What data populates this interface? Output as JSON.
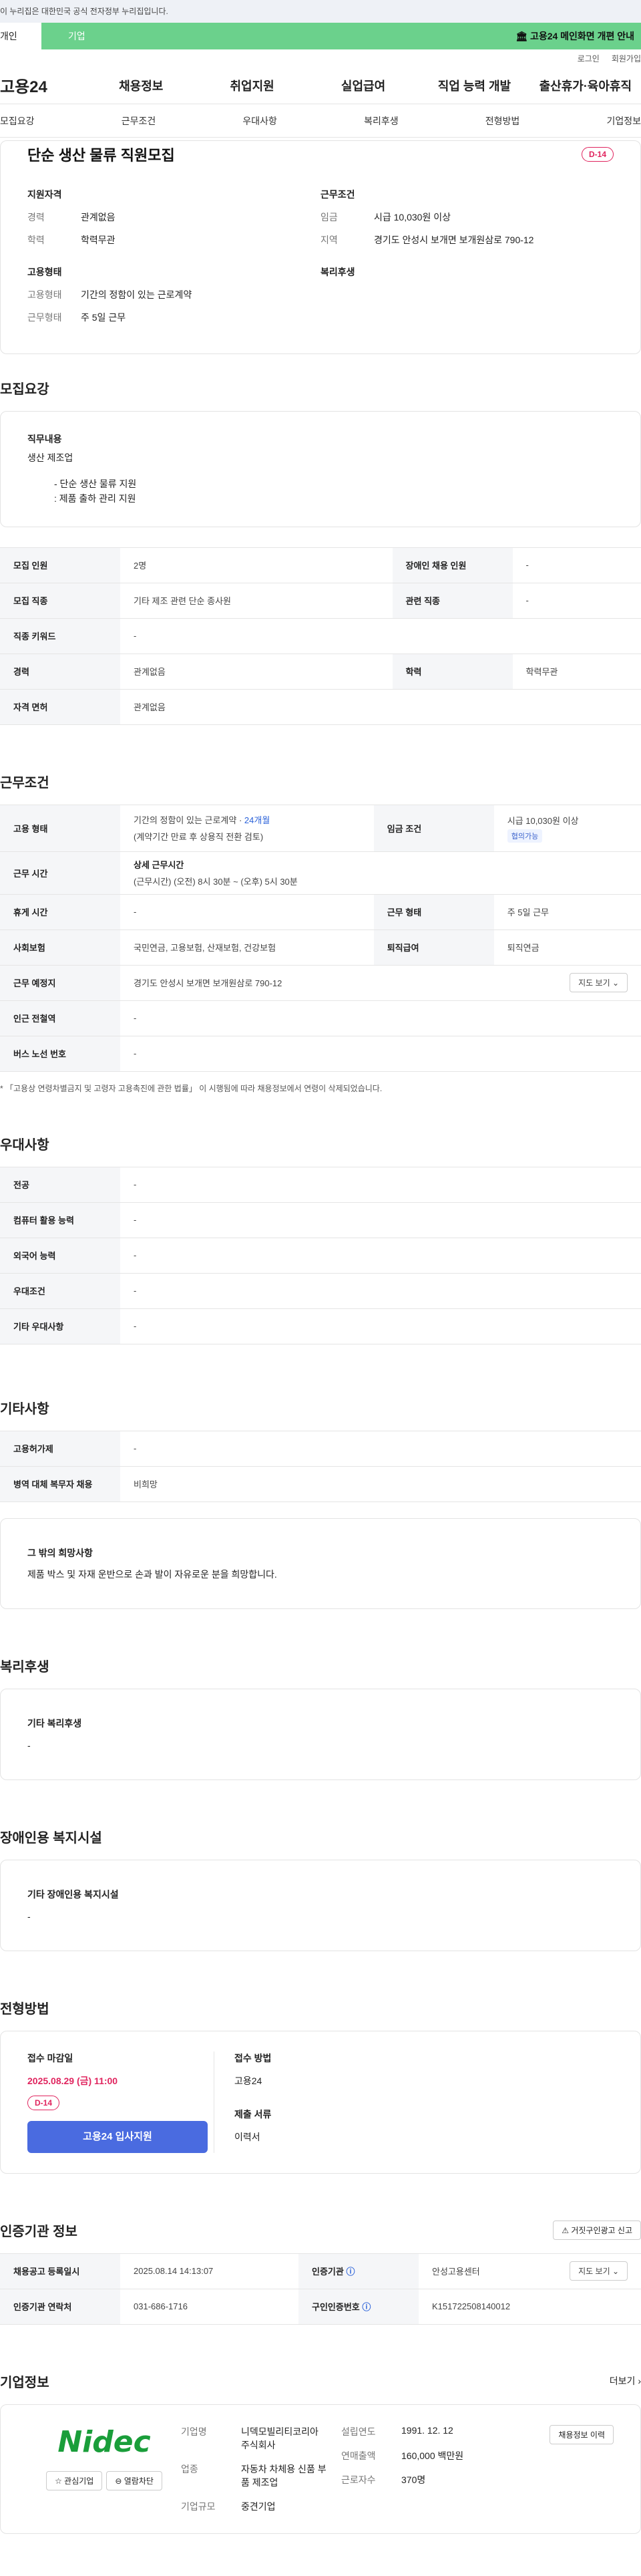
{
  "gov_bar": "이 누리집은 대한민국 공식 전자정부 누리집입니다.",
  "top": {
    "ind": "개인",
    "corp": "기업",
    "notice": "🏛 고용24 메인화면 개편 안내"
  },
  "util": [
    "로그인",
    "회원가입"
  ],
  "logo": "고용24",
  "gnb": [
    "채용정보",
    "취업지원",
    "실업급여",
    "직업 능력 개발",
    "출산휴가·육아휴직"
  ],
  "tabs": [
    "모집요강",
    "근무조건",
    "우대사항",
    "복리후생",
    "전형방법",
    "기업정보"
  ],
  "title": "단순 생산 물류 직원모집",
  "dday": "D-14",
  "summary": {
    "qual": {
      "h": "지원자격",
      "rows": [
        [
          "경력",
          "관계없음"
        ],
        [
          "학력",
          "학력무관"
        ]
      ]
    },
    "cond": {
      "h": "근무조건",
      "rows": [
        [
          "임금",
          "시급 10,030원 이상"
        ],
        [
          "지역",
          "경기도 안성시 보개면 보개원삼로 790-12"
        ]
      ]
    },
    "emp": {
      "h": "고용형태",
      "rows": [
        [
          "고용형태",
          "기간의 정함이 있는 근로계약"
        ],
        [
          "근무형태",
          "주 5일 근무"
        ]
      ]
    },
    "welfare": {
      "h": "복리후생"
    }
  },
  "recruit": {
    "title": "모집요강",
    "job_h": "직무내용",
    "job_text": "생산 제조업",
    "job_list": [
      "- 단순 생산 물류 지원",
      "  : 제품 출하 관리 지원"
    ],
    "rows": [
      [
        "모집 인원",
        "2명",
        "장애인 채용 인원",
        "-"
      ],
      [
        "모집 직종",
        "기타 제조 관련 단순 종사원",
        "관련 직종",
        "-"
      ],
      [
        "직종 키워드",
        "-"
      ],
      [
        "경력",
        "관계없음",
        "학력",
        "학력무관"
      ],
      [
        "자격 면허",
        "관계없음"
      ]
    ]
  },
  "work": {
    "title": "근무조건",
    "emp_k": "고용 형태",
    "emp_v1": "기간의 정함이 있는 근로계약 · ",
    "emp_months": "24개월",
    "emp_v2": "(계약기간 만료 후 상용직 전환 검토)",
    "wage_k": "임금 조건",
    "wage_v": "시급 10,030원 이상",
    "wage_chip": "협의가능",
    "time_k": "근무 시간",
    "time_h": "상세 근무시간",
    "time_v": "(근무시간) (오전) 8시 30분 ~ (오후) 5시 30분",
    "rows": [
      [
        "휴게 시간",
        "-",
        "근무 형태",
        "주 5일 근무"
      ],
      [
        "사회보험",
        "국민연금, 고용보험, 산재보험, 건강보험",
        "퇴직급여",
        "퇴직연금"
      ]
    ],
    "loc_k": "근무 예정지",
    "loc_v": "경기도 안성시 보개면 보개원삼로 790-12",
    "map_btn": "지도 보기 ⌄",
    "rows2": [
      [
        "인근 전철역",
        "-"
      ],
      [
        "버스 노선 번호",
        "-"
      ]
    ],
    "note": "* 「고용상 연령차별금지 및 고령자 고용촉진에 관한 법률」 이 시행됨에 따라 채용정보에서 연령이 삭제되었습니다."
  },
  "pref": {
    "title": "우대사항",
    "rows": [
      [
        "전공",
        "-"
      ],
      [
        "컴퓨터 활용 능력",
        "-"
      ],
      [
        "외국어 능력",
        "-"
      ],
      [
        "우대조건",
        "-"
      ],
      [
        "기타 우대사항",
        "-"
      ]
    ]
  },
  "etc": {
    "title": "기타사항",
    "rows": [
      [
        "고용허가제",
        "-"
      ],
      [
        "병역 대체 복무자 채용",
        "비희망"
      ]
    ],
    "box_h": "그 밖의 희망사항",
    "box_v": "제품 박스 및 자재 운반으로 손과 발이 자유로운 분을 희망합니다."
  },
  "welfare": {
    "title": "복리후생",
    "h": "기타 복리후생",
    "v": "-"
  },
  "disab": {
    "title": "장애인용 복지시설",
    "h": "기타 장애인용 복지시설",
    "v": "-"
  },
  "apply": {
    "title": "전형방법",
    "deadline_h": "접수 마감일",
    "deadline": "2025.08.29 (금) 11:00",
    "dday": "D-14",
    "btn": "고용24 입사지원",
    "method_h": "접수 방법",
    "method": "고용24",
    "docs_h": "제출 서류",
    "docs": "이력서"
  },
  "cert": {
    "title": "인증기관 정보",
    "report": "⚠ 거짓구인광고 신고",
    "rows": [
      [
        "채용공고 등록일시",
        "2025.08.14 14:13:07",
        "인증기관",
        "안성고용센터"
      ],
      [
        "인증기관 연락처",
        "031-686-1716",
        "구인인증번호",
        "K151722508140012"
      ]
    ],
    "map_btn": "지도 보기 ⌄"
  },
  "company": {
    "title": "기업정보",
    "more": "더보기 ›",
    "logo": "Nidec",
    "fav": "☆ 관심기업",
    "block": "⊖ 열람차단",
    "name_k": "기업명",
    "name_v": "니덱모빌리티코리아 주식회사",
    "biz_k": "업종",
    "biz_v": "자동차 차체용 신품 부품 제조업",
    "size_k": "기업규모",
    "size_v": "중견기업",
    "est_k": "설립연도",
    "est_v": "1991. 12. 12",
    "rev_k": "연매출액",
    "rev_v": "160,000 백만원",
    "emp_k": "근로자수",
    "emp_v": "370명",
    "jobs_btn": "채용정보 이력"
  },
  "colors": {
    "green": "#6bd18c",
    "red": "#e0245e",
    "blue": "#4a6be0"
  }
}
